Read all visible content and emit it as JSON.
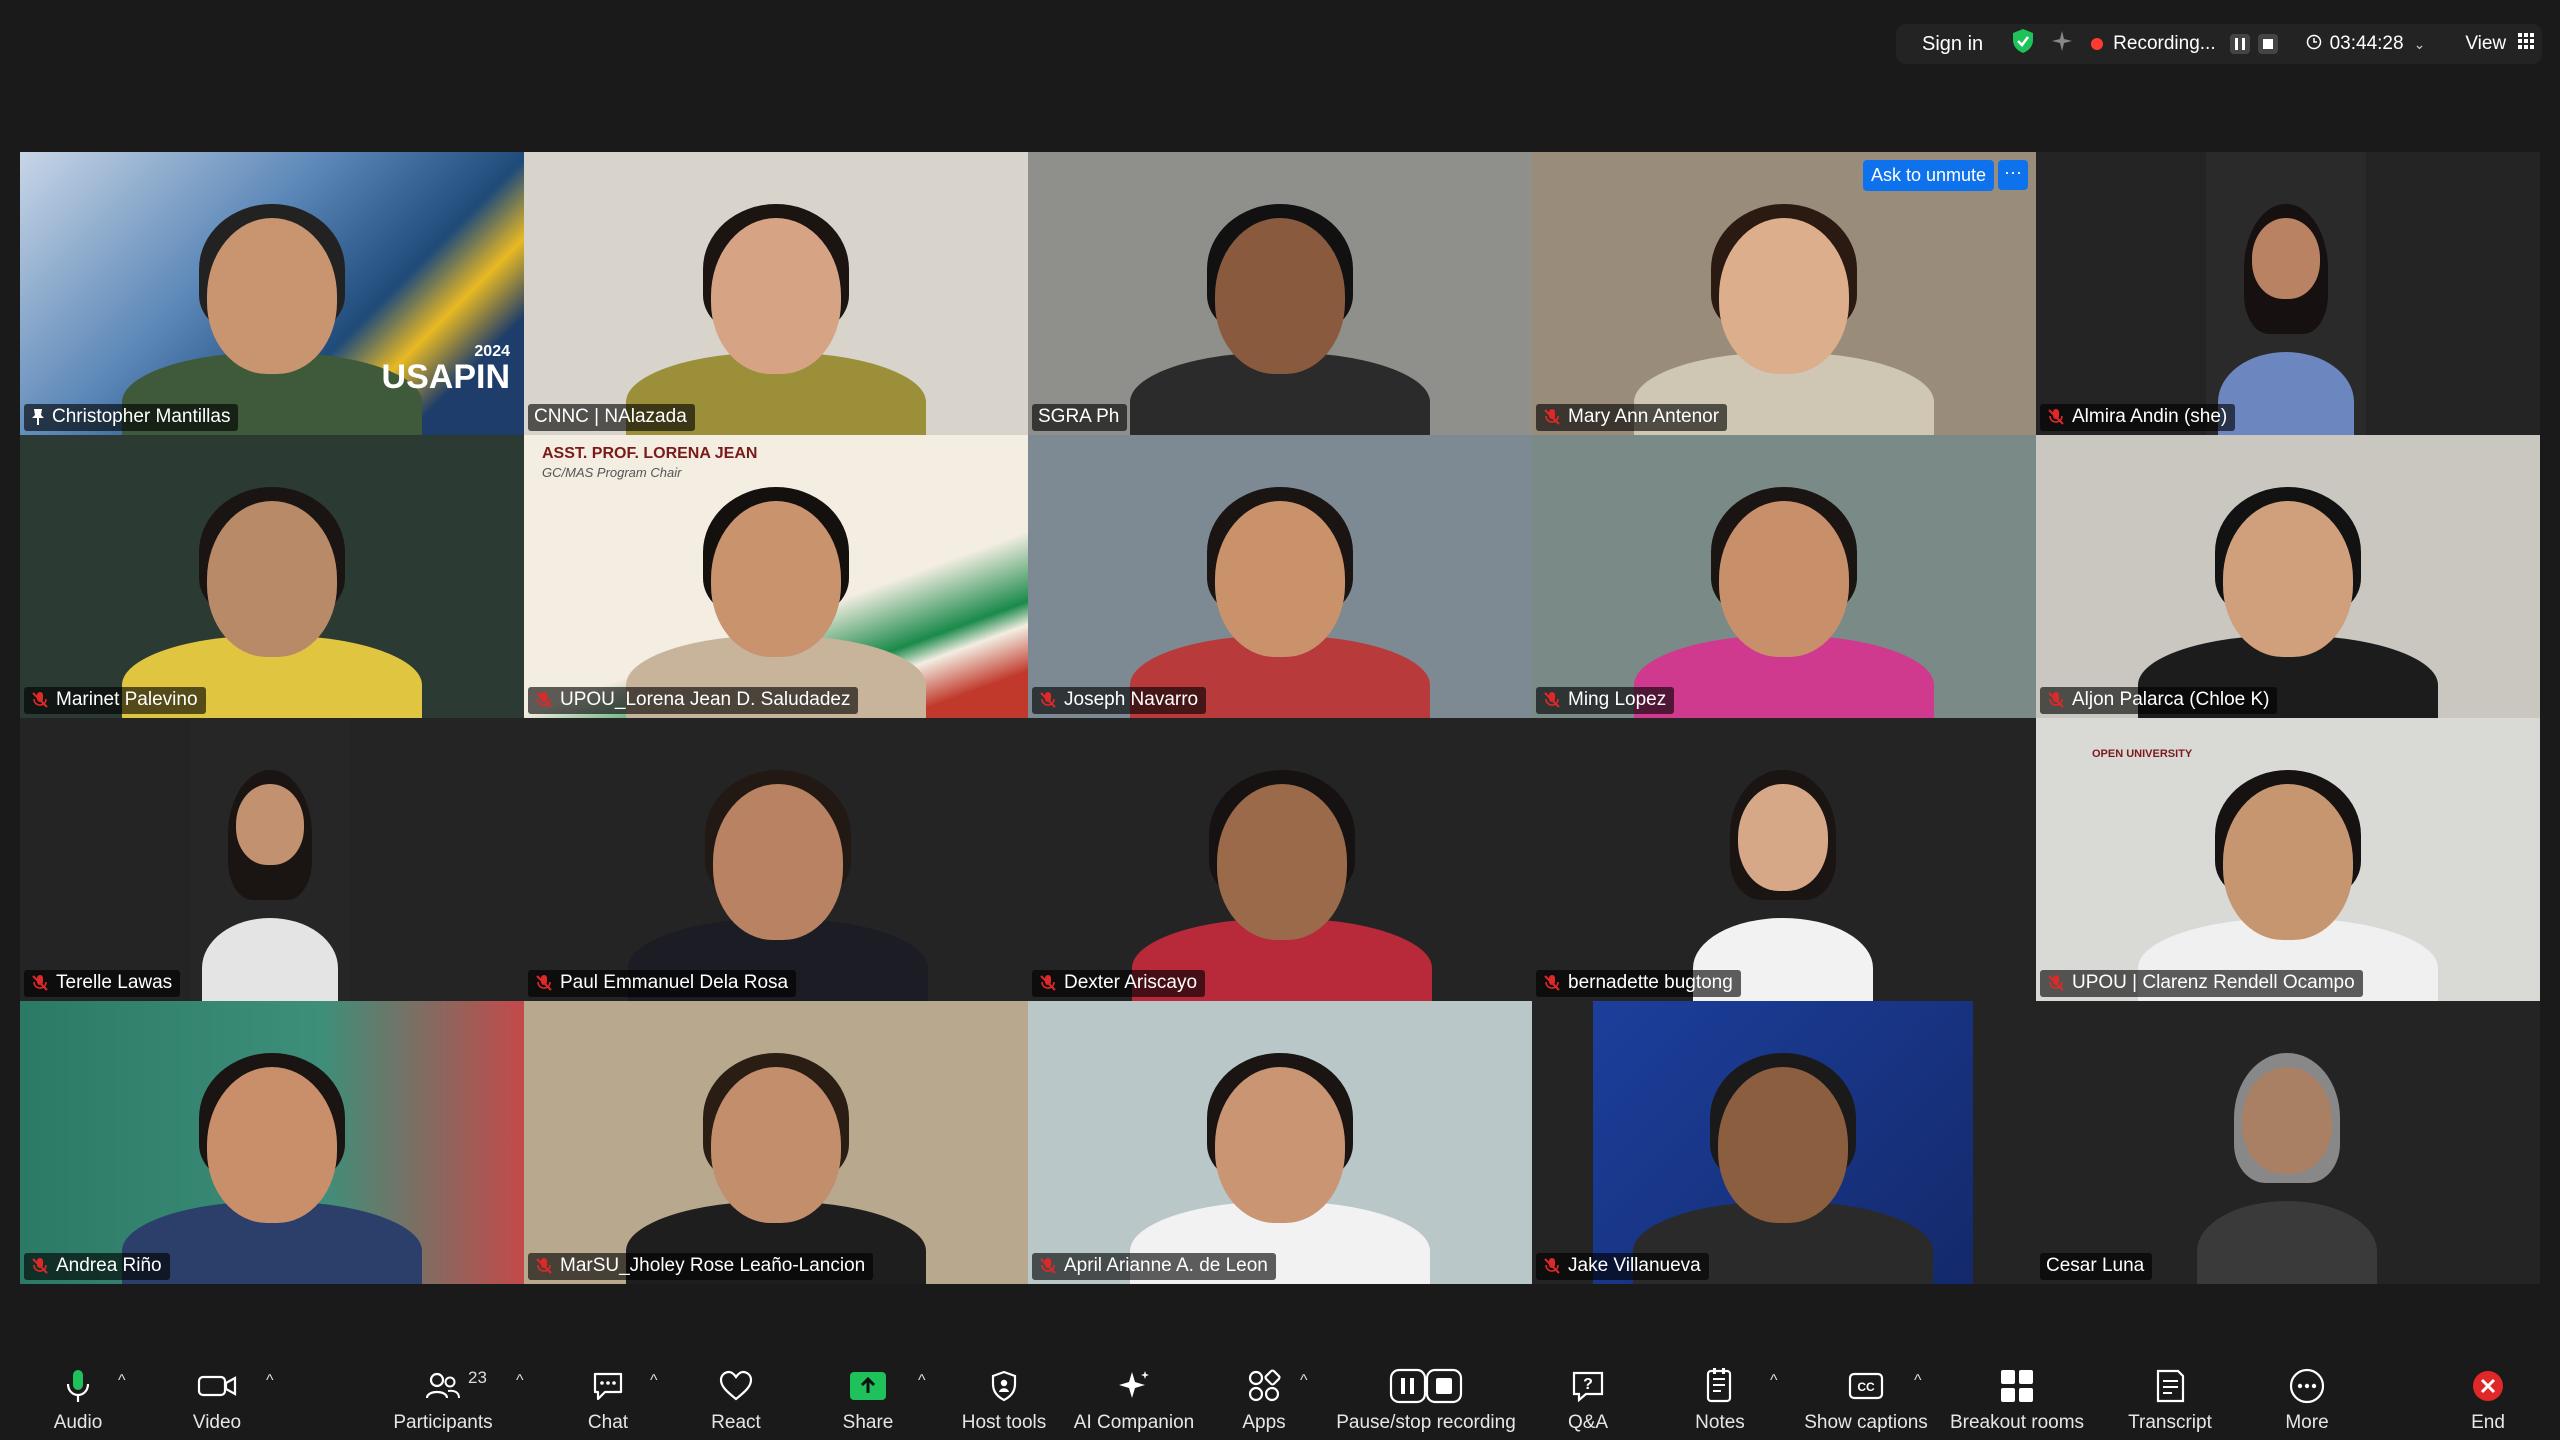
{
  "topbar": {
    "signin": "Sign in",
    "recording": "Recording...",
    "timer": "03:44:28",
    "view": "View"
  },
  "participants_grid": [
    {
      "name": "Christopher Mantillas",
      "muted": false,
      "pinned": true,
      "active": true,
      "bg": "#2b5c8c"
    },
    {
      "name": "CNNC | NAlazada",
      "muted": false,
      "bg": "#d8d4cc"
    },
    {
      "name": "SGRA Ph",
      "muted": false,
      "bg": "#8f8f8c"
    },
    {
      "name": "Mary Ann Antenor",
      "muted": true,
      "bg": "#9a8c7a",
      "ask_to_unmute": "Ask to unmute"
    },
    {
      "name": "Almira Andin (she)",
      "muted": true,
      "bg": "#2a2a2a"
    },
    {
      "name": "Marinet Palevino",
      "muted": true,
      "bg": "#2c3a34"
    },
    {
      "name": "UPOU_Lorena Jean D. Saludadez",
      "muted": true,
      "bg": "#ece5d8"
    },
    {
      "name": "Joseph Navarro",
      "muted": true,
      "bg": "#7d8a94"
    },
    {
      "name": "Ming Lopez",
      "muted": true,
      "bg": "#7a8a86"
    },
    {
      "name": "Aljon Palarca (Chloe K)",
      "muted": true,
      "bg": "#c9c7c0"
    },
    {
      "name": "Terelle Lawas",
      "muted": true,
      "bg": "#262626"
    },
    {
      "name": "Paul Emmanuel Dela Rosa",
      "muted": true,
      "bg": "#242424"
    },
    {
      "name": "Dexter Ariscayo",
      "muted": true,
      "bg": "#242424"
    },
    {
      "name": "bernadette bugtong",
      "muted": true,
      "bg": "#242424"
    },
    {
      "name": "UPOU | Clarenz Rendell Ocampo",
      "muted": true,
      "bg": "#d9d9d6"
    },
    {
      "name": "Andrea Riño",
      "muted": true,
      "bg": "#2f6e5c"
    },
    {
      "name": "MarSU_Jholey Rose Leaño-Lancion",
      "muted": true,
      "bg": "#b8a98e"
    },
    {
      "name": "April Arianne A. de Leon",
      "muted": true,
      "bg": "#b9c7c9"
    },
    {
      "name": "Jake Villanueva",
      "muted": true,
      "bg": "#242424"
    },
    {
      "name": "Cesar Luna",
      "muted": false,
      "bg": "#242424"
    }
  ],
  "tile_text": {
    "banner_word": "USAPIN",
    "banner_year": "2024",
    "lorena_banner": "ASST. PROF. LORENA JEAN",
    "lorena_sub": "GC/MAS Program Chair",
    "upou_logo": "OPEN UNIVERSITY"
  },
  "toolbar": {
    "audio": "Audio",
    "video": "Video",
    "participants": "Participants",
    "participants_count": "23",
    "chat": "Chat",
    "react": "React",
    "share": "Share",
    "host_tools": "Host tools",
    "ai_companion": "AI Companion",
    "apps": "Apps",
    "pause_stop": "Pause/stop recording",
    "qa": "Q&A",
    "notes": "Notes",
    "show_captions": "Show captions",
    "breakout": "Breakout rooms",
    "transcript": "Transcript",
    "more": "More",
    "end": "End"
  },
  "colors": {
    "accent": "#0e72ed",
    "active_speaker": "#29d17c",
    "share": "#1ec15a",
    "end": "#e02828",
    "recording": "#ff3b30"
  }
}
